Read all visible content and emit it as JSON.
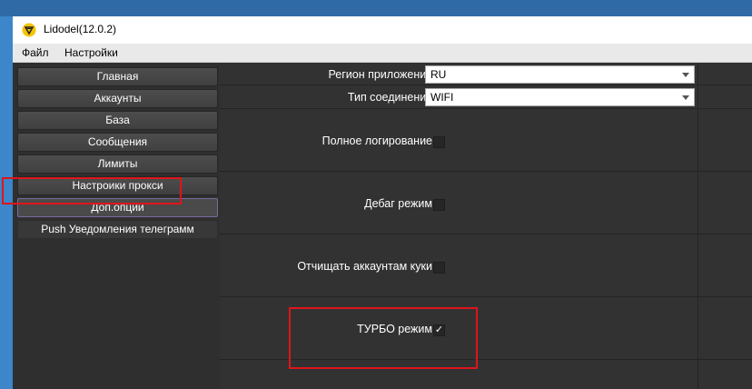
{
  "window": {
    "title": "Lidodel(12.0.2)",
    "icon": "lidodel-logo-icon"
  },
  "menu": [
    "Файл",
    "Настройки"
  ],
  "sidebar": {
    "items": [
      {
        "label": "Главная"
      },
      {
        "label": "Аккаунты"
      },
      {
        "label": "База"
      },
      {
        "label": "Сообщения"
      },
      {
        "label": "Лимиты"
      },
      {
        "label": "Настроики прокси"
      },
      {
        "label": "Доп.опции"
      },
      {
        "label": "Push Уведомления телеграмм"
      }
    ],
    "selected": "Доп.опции"
  },
  "settings": {
    "region": {
      "label": "Регион приложения",
      "value": "RU"
    },
    "connection": {
      "label": "Тип соединения",
      "value": "WIFI"
    },
    "full_logging": {
      "label": "Полное логирование",
      "checked": false
    },
    "debug": {
      "label": "Дебаг режим",
      "checked": false
    },
    "clear_cookies": {
      "label": "Отчищать аккаунтам куки",
      "checked": false
    },
    "turbo": {
      "label": "ТУРБО режим",
      "checked": true,
      "mark": "✓"
    }
  },
  "colors": {
    "highlight": "#e0141b",
    "panel_bg": "#323232",
    "sidebar_bg": "#2f2f2f",
    "button_bg": "#454545"
  }
}
